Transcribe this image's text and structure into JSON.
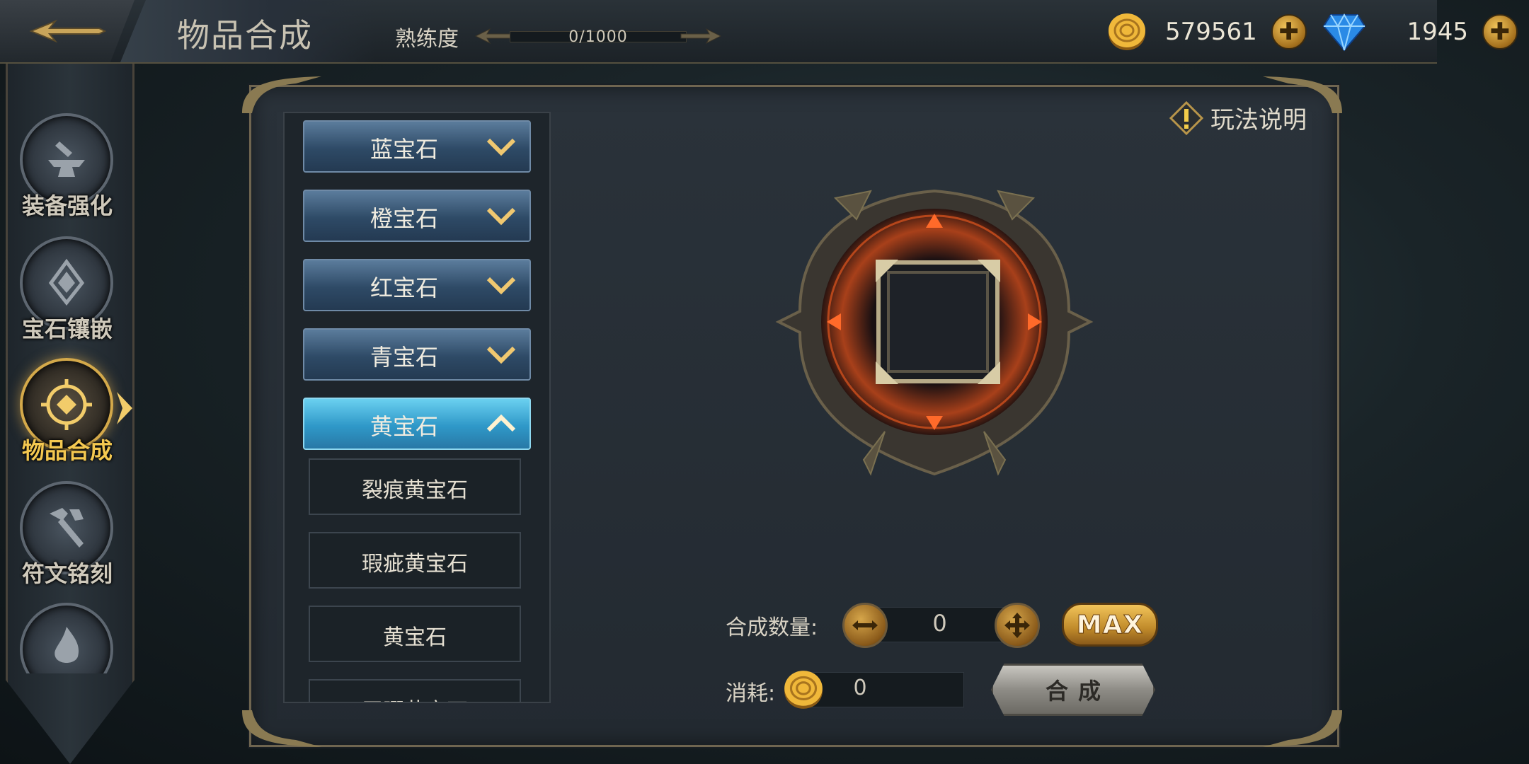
{
  "header": {
    "title": "物品合成",
    "proficiency_label": "熟练度",
    "proficiency_value": "0/1000",
    "proficiency_fraction": 0
  },
  "currency": {
    "gold": "579561",
    "diamond": "1945"
  },
  "sidebar": {
    "items": [
      {
        "label": "装备强化",
        "icon": "anvil-icon"
      },
      {
        "label": "宝石镶嵌",
        "icon": "gem-socket-icon"
      },
      {
        "label": "物品合成",
        "icon": "compass-diamond-icon",
        "active": true
      },
      {
        "label": "符文铭刻",
        "icon": "hammer-icon"
      },
      {
        "label": "",
        "icon": "flame-icon"
      }
    ]
  },
  "categories": [
    {
      "label": "蓝宝石",
      "open": false
    },
    {
      "label": "橙宝石",
      "open": false
    },
    {
      "label": "红宝石",
      "open": false
    },
    {
      "label": "青宝石",
      "open": false
    },
    {
      "label": "黄宝石",
      "open": true
    }
  ],
  "subitems": [
    "裂痕黄宝石",
    "瑕疵黄宝石",
    "黄宝石",
    "无暇黄宝石"
  ],
  "help_label": "玩法说明",
  "controls": {
    "quantity_label": "合成数量:",
    "quantity_value": "0",
    "max_label": "MAX",
    "cost_label": "消耗:",
    "cost_value": "0",
    "synth_label": "合成"
  },
  "colors": {
    "accent_gold": "#d4a94a",
    "category_blue": "#2e4a66",
    "category_active": "#2f98c8",
    "ring_orange": "#e0551e"
  }
}
